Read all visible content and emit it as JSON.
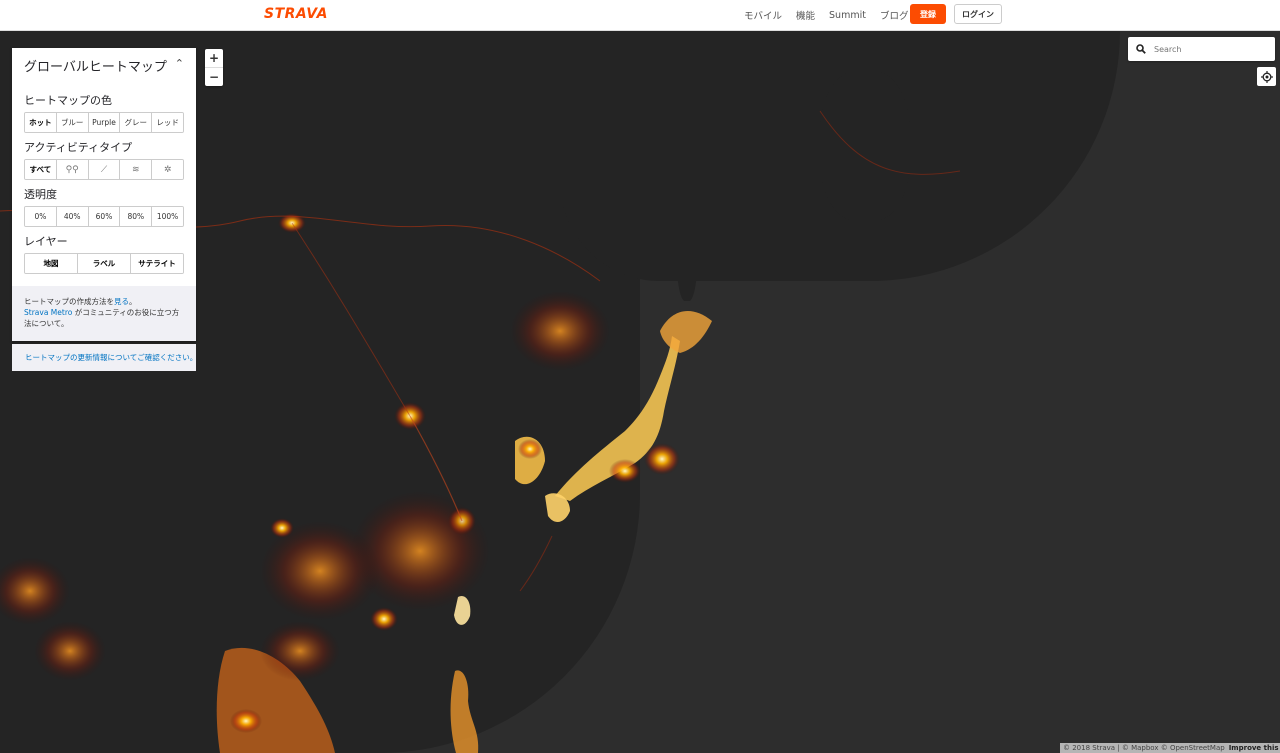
{
  "header": {
    "logo": "STRAVA",
    "nav": [
      "モバイル",
      "機能",
      "Summit",
      "ブログ"
    ],
    "signup_label": "登録",
    "login_label": "ログイン",
    "accent_color": "#fc4c02"
  },
  "panel": {
    "title": "グローバルヒートマップ",
    "color_section": "ヒートマップの色",
    "color_options": [
      "ホット",
      "ブルー",
      "Purple",
      "グレー",
      "レッド"
    ],
    "activity_section": "アクティビティタイプ",
    "activity_all": "すべて",
    "activity_icons": [
      "bike-icon",
      "run-icon",
      "water-icon",
      "snow-icon"
    ],
    "opacity_section": "透明度",
    "opacity_options": [
      "0%",
      "40%",
      "60%",
      "80%",
      "100%"
    ],
    "layer_section": "レイヤー",
    "layer_options": [
      "地図",
      "ラベル",
      "サテライト"
    ],
    "footer_prefix": "ヒートマップの作成方法を",
    "footer_link": "見る",
    "footer_suffix": "。",
    "metro_link": "Strava Metro",
    "metro_text": " がコミュニティのお役に立つ方法について。",
    "update_link": "ヒートマップの更新情報についてご確認ください。"
  },
  "map": {
    "zoom_in": "+",
    "zoom_out": "−",
    "search_placeholder": "Search",
    "locate_icon": "locate-icon",
    "attribution": "© 2018 Strava | © Mapbox © OpenStreetMap",
    "improve_link": "Improve this map"
  }
}
